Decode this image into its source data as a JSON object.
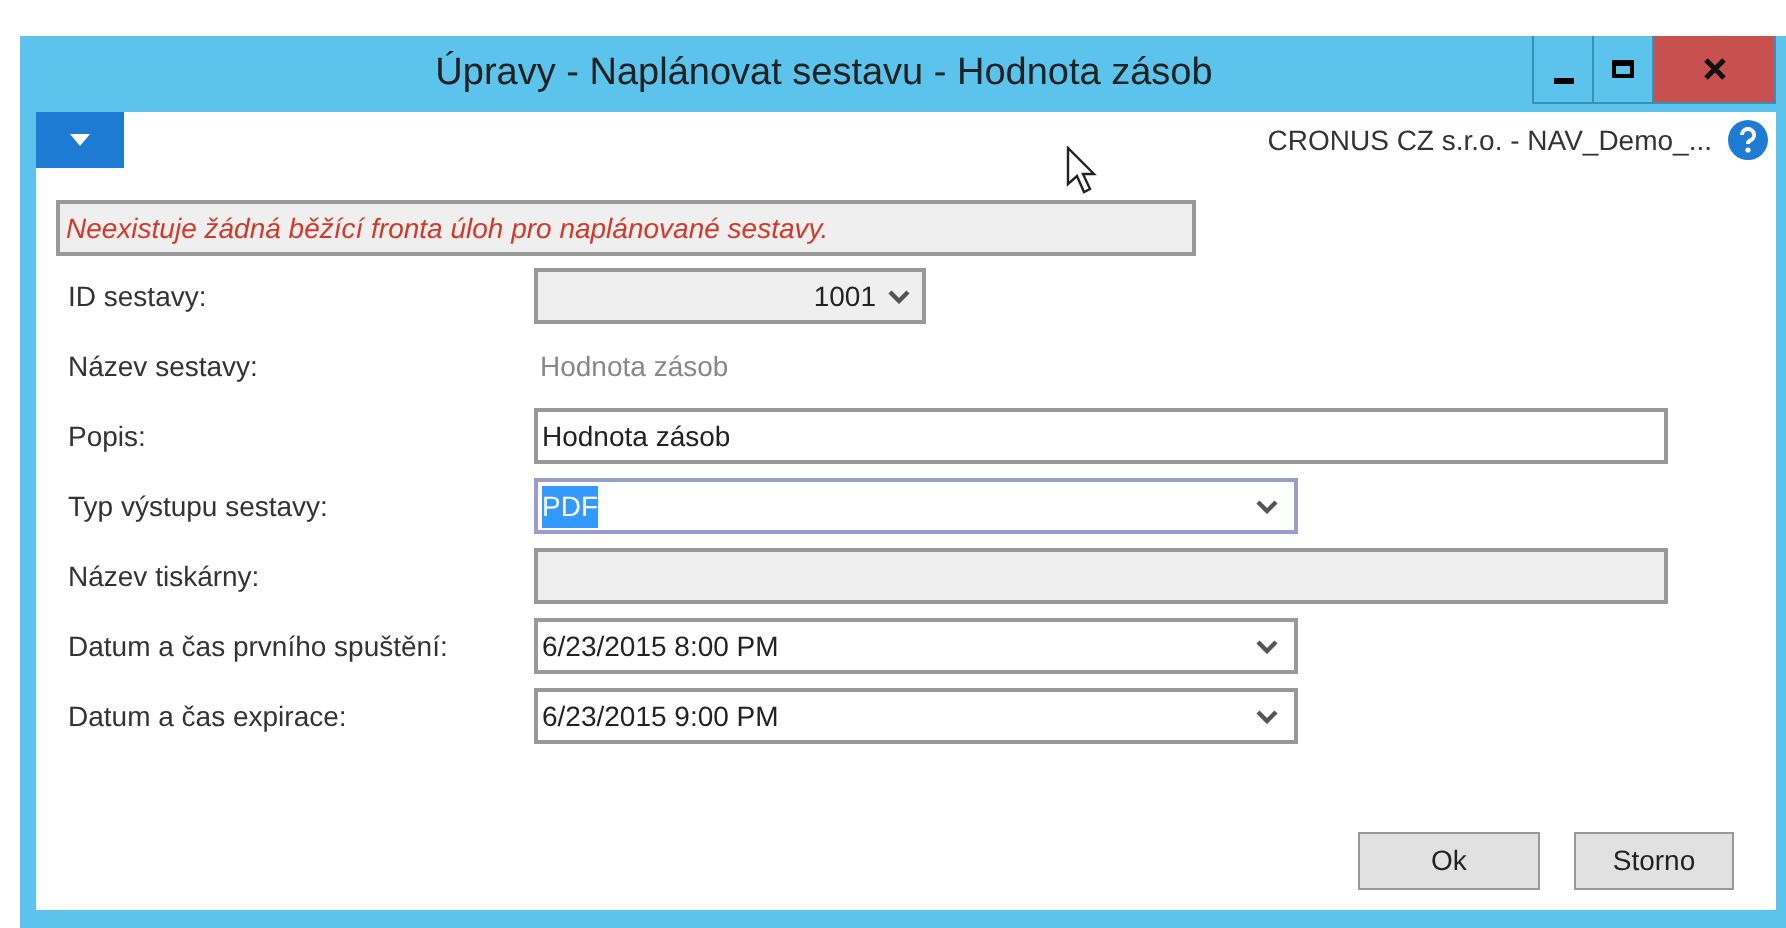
{
  "window": {
    "title": "Úpravy - Naplánovat sestavu - Hodnota zásob"
  },
  "toolbar": {
    "company": "CRONUS CZ s.r.o. - NAV_Demo_..."
  },
  "message": "Neexistuje žádná běžící fronta úloh pro naplánované sestavy.",
  "fields": [
    {
      "kind": "lookup",
      "label": "ID sestavy:",
      "value": "1001"
    },
    {
      "kind": "static",
      "label": "Název sestavy:",
      "value": "Hodnota zásob"
    },
    {
      "kind": "text",
      "label": "Popis:",
      "value": "Hodnota zásob",
      "disabled": false
    },
    {
      "kind": "dropdown",
      "label": "Typ výstupu sestavy:",
      "value": "PDF",
      "focused": true
    },
    {
      "kind": "text",
      "label": "Název tiskárny:",
      "disabled": true
    },
    {
      "kind": "dropdown",
      "label": "Datum a čas prvního spuštění:",
      "value": "6/23/2015 8:00 PM",
      "focused": false
    },
    {
      "kind": "dropdown",
      "label": "Datum a čas expirace:",
      "value": "6/23/2015 9:00 PM",
      "focused": false
    }
  ],
  "buttons": [
    "Ok",
    "Storno"
  ]
}
